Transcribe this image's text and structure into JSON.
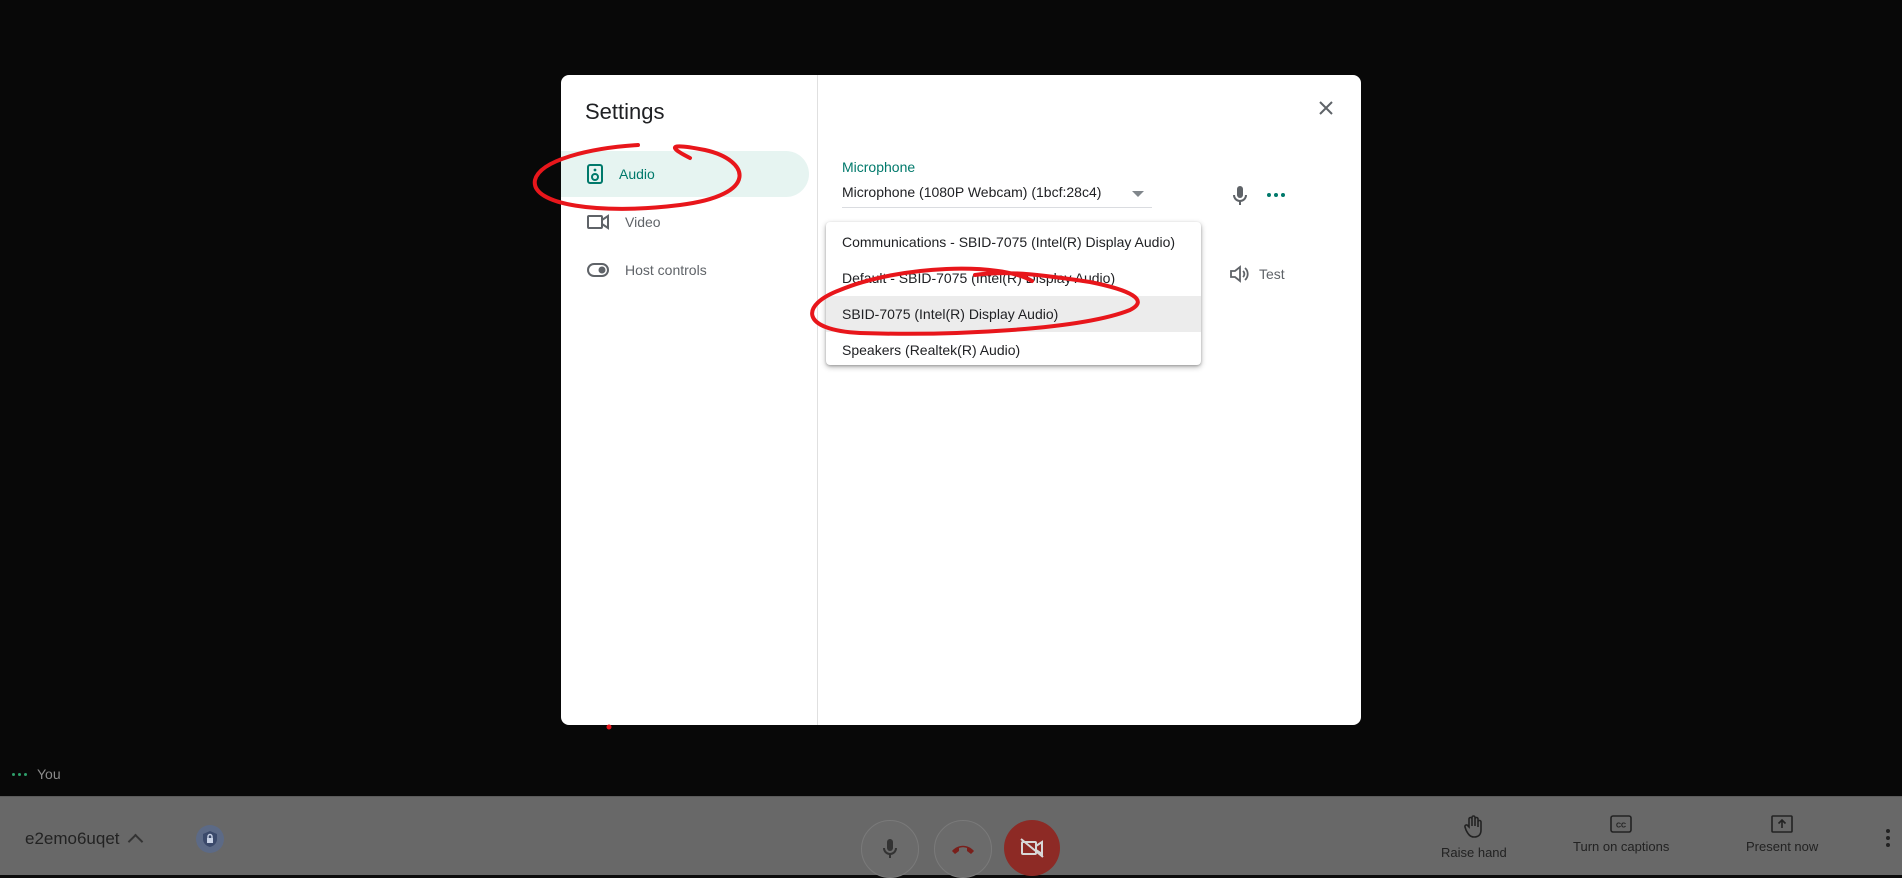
{
  "settings": {
    "title": "Settings",
    "nav": [
      {
        "label": "Audio",
        "icon": "speaker-icon",
        "active": true
      },
      {
        "label": "Video",
        "icon": "videocam-icon",
        "active": false
      },
      {
        "label": "Host controls",
        "icon": "toggle-icon",
        "active": false
      }
    ],
    "close_icon": "close-icon",
    "microphone": {
      "label": "Microphone",
      "selected": "Microphone (1080P Webcam) (1bcf:28c4)",
      "options": [
        "Communications - SBID-7075 (Intel(R) Display Audio)",
        "Default - SBID-7075 (Intel(R) Display Audio)",
        "SBID-7075 (Intel(R) Display Audio)",
        "Speakers (Realtek(R) Audio)"
      ],
      "highlighted_index": 2
    },
    "test_label": "Test",
    "accent": "#00796b"
  },
  "self_view": {
    "label": "You"
  },
  "control_bar": {
    "meeting_code": "e2emo6uqet",
    "raise_hand": "Raise hand",
    "captions": "Turn on captions",
    "present": "Present now",
    "camera_off_color": "#8d2a25"
  },
  "annotation_color": "#e8161b"
}
